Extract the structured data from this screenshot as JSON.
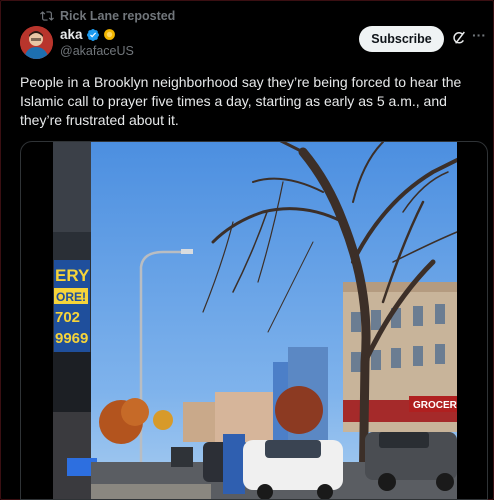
{
  "repost": {
    "icon": "repost-icon",
    "text": "Rick Lane reposted"
  },
  "author": {
    "name": "aka",
    "handle": "@akafaceUS",
    "avatar_icon": "avatar-image",
    "verified_icon": "verified-badge-icon",
    "affiliate_icon": "gold-badge-icon"
  },
  "actions": {
    "subscribe_label": "Subscribe",
    "grok_icon": "grok-icon",
    "more_icon": "more-icon",
    "more_glyph": "···"
  },
  "tweet": {
    "text": "People in a Brooklyn neighborhood say they’re being forced to hear the Islamic call to prayer five times a day, starting as early as 5 a.m., and they’re frustrated about it."
  },
  "media": {
    "type": "video-thumbnail",
    "storefront_text": [
      "ERY",
      "ORE!",
      "702",
      "9969"
    ],
    "grocery_sign": "GROCERY"
  },
  "colors": {
    "background": "#000000",
    "text": "#e7e9ea",
    "muted": "#71767b",
    "verified": "#1d9bf0",
    "sky": "#5f9ee5"
  }
}
